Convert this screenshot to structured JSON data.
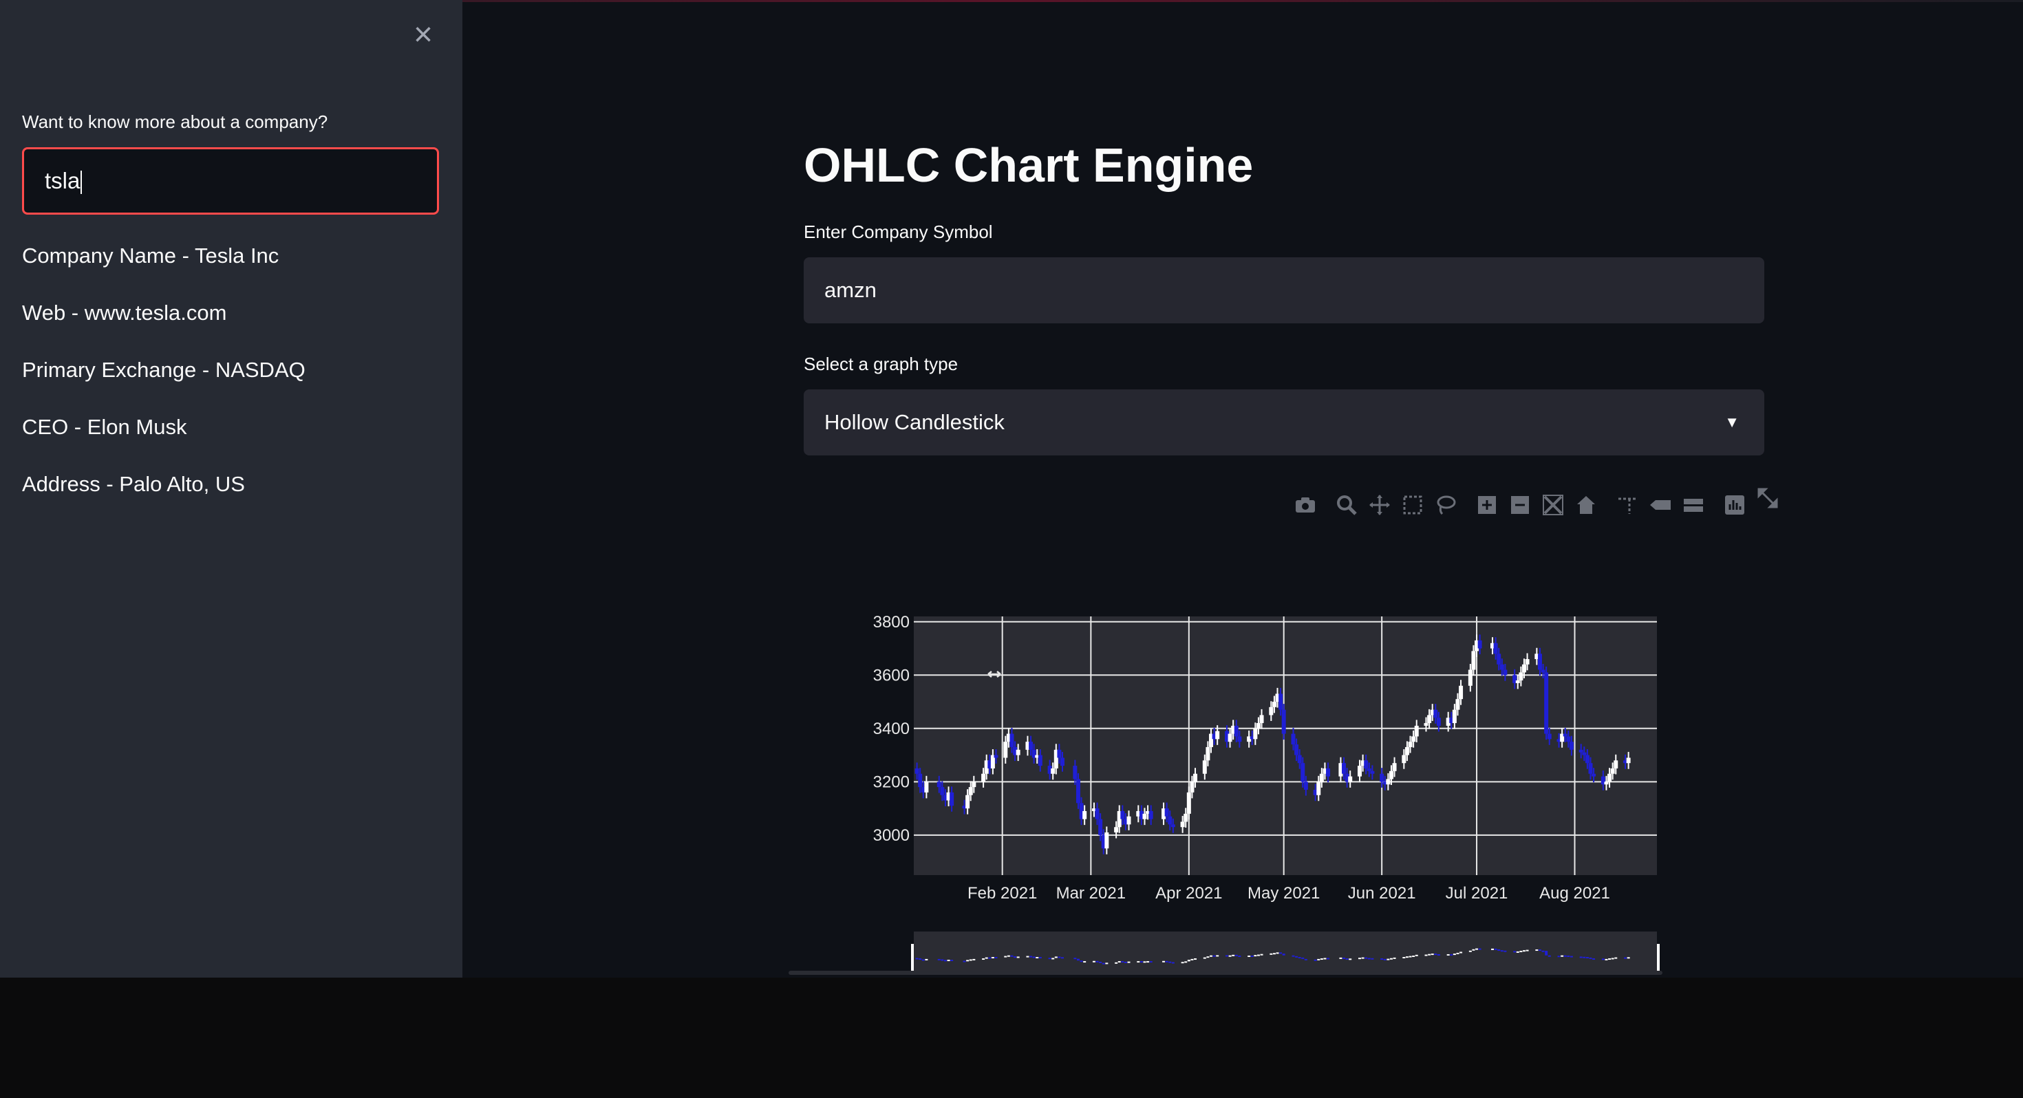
{
  "sidebar": {
    "close_icon": "close-icon",
    "company_prompt": "Want to know more about a company?",
    "search_value": "tsla",
    "info": [
      "Company Name - Tesla Inc",
      "Web - www.tesla.com",
      "Primary Exchange - NASDAQ",
      "CEO - Elon Musk",
      "Address - Palo Alto, US"
    ]
  },
  "main": {
    "title": "OHLC Chart Engine",
    "symbol_label": "Enter Company Symbol",
    "symbol_value": "amzn",
    "graph_type_label": "Select a graph type",
    "graph_type_value": "Hollow Candlestick"
  },
  "modebar": {
    "icons": [
      "camera-icon",
      "zoom-icon",
      "pan-icon",
      "box-select-icon",
      "lasso-icon",
      "zoom-in-icon",
      "zoom-out-icon",
      "autoscale-icon",
      "reset-axes-icon",
      "spike-lines-icon",
      "hover-closest-icon",
      "hover-compare-icon",
      "plotly-logo-icon",
      "fullscreen-icon"
    ]
  },
  "colors": {
    "sidebar_bg": "#262a33",
    "app_bg": "#0e1117",
    "input_border": "#ff4b4b",
    "plot_bg": "#2b2c33",
    "increasing": "#ffffff",
    "decreasing": "#1f1fd6"
  },
  "chart_data": {
    "type": "candlestick",
    "ylim": [
      2850,
      3820
    ],
    "yticks": [
      3000,
      3200,
      3400,
      3600,
      3800
    ],
    "xticks": [
      "Feb 2021",
      "Mar 2021",
      "Apr 2021",
      "May 2021",
      "Jun 2021",
      "Jul 2021",
      "Aug 2021"
    ],
    "xtick_days": [
      31,
      59,
      90,
      120,
      151,
      181,
      212
    ],
    "xlim_days": [
      3,
      238
    ],
    "x_day_origin": "2021-01-01",
    "closes": [
      {
        "day": 4,
        "close": 3230
      },
      {
        "day": 5,
        "close": 3180
      },
      {
        "day": 6,
        "close": 3160
      },
      {
        "day": 7,
        "close": 3200
      },
      {
        "day": 11,
        "close": 3180
      },
      {
        "day": 12,
        "close": 3150
      },
      {
        "day": 13,
        "close": 3130
      },
      {
        "day": 14,
        "close": 3160
      },
      {
        "day": 15,
        "close": 3110
      },
      {
        "day": 19,
        "close": 3100
      },
      {
        "day": 20,
        "close": 3150
      },
      {
        "day": 21,
        "close": 3180
      },
      {
        "day": 22,
        "close": 3200
      },
      {
        "day": 25,
        "close": 3230
      },
      {
        "day": 26,
        "close": 3280
      },
      {
        "day": 27,
        "close": 3250
      },
      {
        "day": 28,
        "close": 3300
      },
      {
        "day": 29,
        "close": 3290
      },
      {
        "day": 32,
        "close": 3350
      },
      {
        "day": 33,
        "close": 3380
      },
      {
        "day": 34,
        "close": 3330
      },
      {
        "day": 35,
        "close": 3300
      },
      {
        "day": 36,
        "close": 3320
      },
      {
        "day": 39,
        "close": 3350
      },
      {
        "day": 40,
        "close": 3320
      },
      {
        "day": 41,
        "close": 3290
      },
      {
        "day": 42,
        "close": 3300
      },
      {
        "day": 43,
        "close": 3260
      },
      {
        "day": 46,
        "close": 3230
      },
      {
        "day": 47,
        "close": 3250
      },
      {
        "day": 48,
        "close": 3320
      },
      {
        "day": 49,
        "close": 3290
      },
      {
        "day": 50,
        "close": 3260
      },
      {
        "day": 54,
        "close": 3210
      },
      {
        "day": 55,
        "close": 3120
      },
      {
        "day": 56,
        "close": 3060
      },
      {
        "day": 57,
        "close": 3090
      },
      {
        "day": 60,
        "close": 3100
      },
      {
        "day": 61,
        "close": 3060
      },
      {
        "day": 62,
        "close": 3000
      },
      {
        "day": 63,
        "close": 2950
      },
      {
        "day": 64,
        "close": 3010
      },
      {
        "day": 67,
        "close": 3030
      },
      {
        "day": 68,
        "close": 3090
      },
      {
        "day": 69,
        "close": 3060
      },
      {
        "day": 70,
        "close": 3040
      },
      {
        "day": 71,
        "close": 3070
      },
      {
        "day": 74,
        "close": 3090
      },
      {
        "day": 75,
        "close": 3060
      },
      {
        "day": 76,
        "close": 3080
      },
      {
        "day": 77,
        "close": 3090
      },
      {
        "day": 78,
        "close": 3060
      },
      {
        "day": 82,
        "close": 3100
      },
      {
        "day": 83,
        "close": 3070
      },
      {
        "day": 84,
        "close": 3040
      },
      {
        "day": 85,
        "close": 3030
      },
      {
        "day": 88,
        "close": 3050
      },
      {
        "day": 89,
        "close": 3080
      },
      {
        "day": 90,
        "close": 3160
      },
      {
        "day": 91,
        "close": 3200
      },
      {
        "day": 92,
        "close": 3230
      },
      {
        "day": 95,
        "close": 3280
      },
      {
        "day": 96,
        "close": 3330
      },
      {
        "day": 97,
        "close": 3380
      },
      {
        "day": 98,
        "close": 3360
      },
      {
        "day": 99,
        "close": 3390
      },
      {
        "day": 102,
        "close": 3350
      },
      {
        "day": 103,
        "close": 3380
      },
      {
        "day": 104,
        "close": 3410
      },
      {
        "day": 105,
        "close": 3370
      },
      {
        "day": 106,
        "close": 3350
      },
      {
        "day": 109,
        "close": 3370
      },
      {
        "day": 110,
        "close": 3360
      },
      {
        "day": 111,
        "close": 3400
      },
      {
        "day": 112,
        "close": 3420
      },
      {
        "day": 113,
        "close": 3450
      },
      {
        "day": 116,
        "close": 3480
      },
      {
        "day": 117,
        "close": 3500
      },
      {
        "day": 118,
        "close": 3530
      },
      {
        "day": 119,
        "close": 3470
      },
      {
        "day": 120,
        "close": 3380
      },
      {
        "day": 123,
        "close": 3340
      },
      {
        "day": 124,
        "close": 3300
      },
      {
        "day": 125,
        "close": 3270
      },
      {
        "day": 126,
        "close": 3200
      },
      {
        "day": 127,
        "close": 3170
      },
      {
        "day": 130,
        "close": 3150
      },
      {
        "day": 131,
        "close": 3200
      },
      {
        "day": 132,
        "close": 3230
      },
      {
        "day": 133,
        "close": 3250
      },
      {
        "day": 134,
        "close": 3220
      },
      {
        "day": 138,
        "close": 3270
      },
      {
        "day": 139,
        "close": 3230
      },
      {
        "day": 140,
        "close": 3200
      },
      {
        "day": 141,
        "close": 3220
      },
      {
        "day": 144,
        "close": 3260
      },
      {
        "day": 145,
        "close": 3280
      },
      {
        "day": 146,
        "close": 3250
      },
      {
        "day": 147,
        "close": 3240
      },
      {
        "day": 148,
        "close": 3230
      },
      {
        "day": 151,
        "close": 3200
      },
      {
        "day": 152,
        "close": 3190
      },
      {
        "day": 153,
        "close": 3210
      },
      {
        "day": 154,
        "close": 3240
      },
      {
        "day": 155,
        "close": 3270
      },
      {
        "day": 158,
        "close": 3300
      },
      {
        "day": 159,
        "close": 3330
      },
      {
        "day": 160,
        "close": 3350
      },
      {
        "day": 161,
        "close": 3370
      },
      {
        "day": 162,
        "close": 3410
      },
      {
        "day": 165,
        "close": 3420
      },
      {
        "day": 166,
        "close": 3450
      },
      {
        "day": 167,
        "close": 3470
      },
      {
        "day": 168,
        "close": 3440
      },
      {
        "day": 169,
        "close": 3410
      },
      {
        "day": 172,
        "close": 3440
      },
      {
        "day": 173,
        "close": 3420
      },
      {
        "day": 174,
        "close": 3470
      },
      {
        "day": 175,
        "close": 3510
      },
      {
        "day": 176,
        "close": 3560
      },
      {
        "day": 179,
        "close": 3620
      },
      {
        "day": 180,
        "close": 3690
      },
      {
        "day": 181,
        "close": 3730
      },
      {
        "day": 182,
        "close": 3700
      },
      {
        "day": 186,
        "close": 3720
      },
      {
        "day": 187,
        "close": 3680
      },
      {
        "day": 188,
        "close": 3640
      },
      {
        "day": 189,
        "close": 3620
      },
      {
        "day": 190,
        "close": 3600
      },
      {
        "day": 193,
        "close": 3570
      },
      {
        "day": 194,
        "close": 3580
      },
      {
        "day": 195,
        "close": 3610
      },
      {
        "day": 196,
        "close": 3640
      },
      {
        "day": 197,
        "close": 3660
      },
      {
        "day": 200,
        "close": 3680
      },
      {
        "day": 201,
        "close": 3620
      },
      {
        "day": 202,
        "close": 3610
      },
      {
        "day": 203,
        "close": 3380
      },
      {
        "day": 204,
        "close": 3360
      },
      {
        "day": 207,
        "close": 3350
      },
      {
        "day": 208,
        "close": 3380
      },
      {
        "day": 209,
        "close": 3370
      },
      {
        "day": 210,
        "close": 3350
      },
      {
        "day": 211,
        "close": 3320
      },
      {
        "day": 214,
        "close": 3310
      },
      {
        "day": 215,
        "close": 3300
      },
      {
        "day": 216,
        "close": 3270
      },
      {
        "day": 217,
        "close": 3230
      },
      {
        "day": 218,
        "close": 3220
      },
      {
        "day": 221,
        "close": 3190
      },
      {
        "day": 222,
        "close": 3200
      },
      {
        "day": 223,
        "close": 3230
      },
      {
        "day": 224,
        "close": 3250
      },
      {
        "day": 225,
        "close": 3280
      },
      {
        "day": 228,
        "close": 3270
      },
      {
        "day": 229,
        "close": 3290
      }
    ]
  }
}
